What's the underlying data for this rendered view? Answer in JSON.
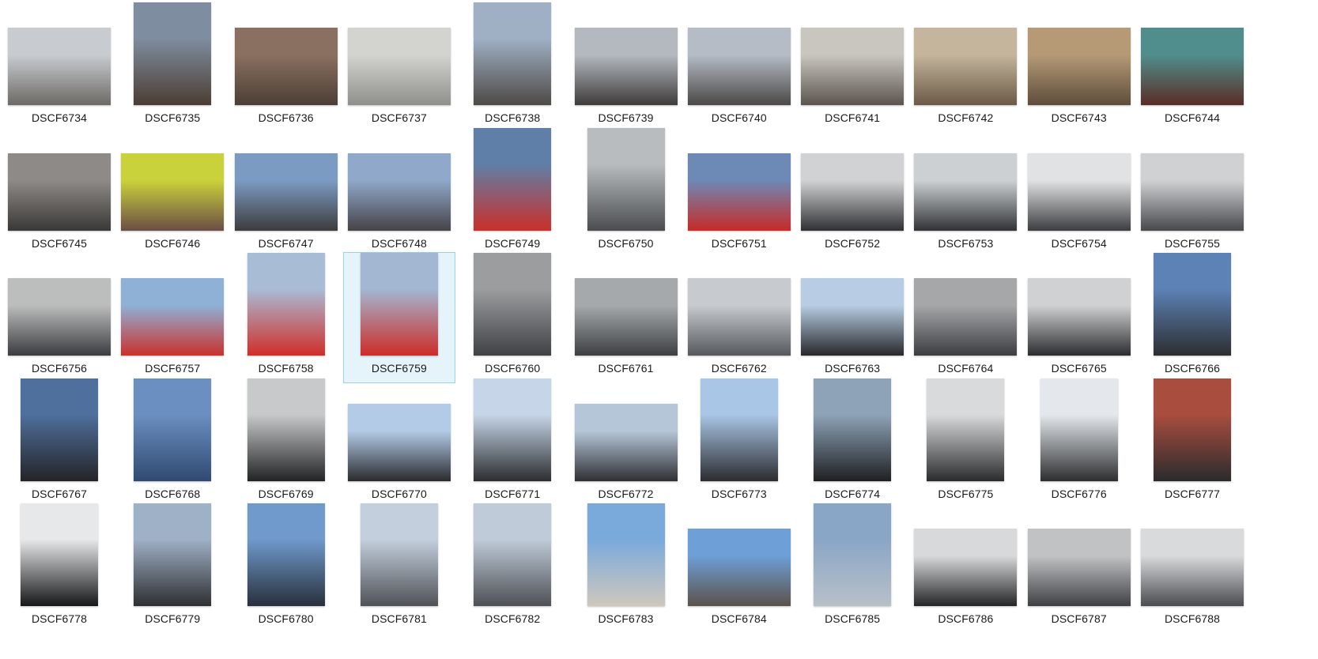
{
  "files": [
    {
      "name": "DSCF6734",
      "orientation": "land",
      "colors": [
        "#c8ccd0",
        "#6d6a66"
      ]
    },
    {
      "name": "DSCF6735",
      "orientation": "port",
      "colors": [
        "#7f8da0",
        "#4b3d33"
      ]
    },
    {
      "name": "DSCF6736",
      "orientation": "land",
      "colors": [
        "#8a7060",
        "#4c3e36"
      ]
    },
    {
      "name": "DSCF6737",
      "orientation": "land",
      "colors": [
        "#d3d3cf",
        "#8f908c"
      ]
    },
    {
      "name": "DSCF6738",
      "orientation": "port",
      "colors": [
        "#9fb0c5",
        "#4e4a46"
      ]
    },
    {
      "name": "DSCF6739",
      "orientation": "land",
      "colors": [
        "#b4b9c0",
        "#3f3c3a"
      ]
    },
    {
      "name": "DSCF6740",
      "orientation": "land",
      "colors": [
        "#b5bcc6",
        "#4b4846"
      ]
    },
    {
      "name": "DSCF6741",
      "orientation": "land",
      "colors": [
        "#c9c5bf",
        "#5b554e"
      ]
    },
    {
      "name": "DSCF6742",
      "orientation": "land",
      "colors": [
        "#c4b59c",
        "#6a5a47"
      ]
    },
    {
      "name": "DSCF6743",
      "orientation": "land",
      "colors": [
        "#b59a75",
        "#5e4d3c"
      ]
    },
    {
      "name": "DSCF6744",
      "orientation": "land",
      "colors": [
        "#4f8e8c",
        "#5a2d26"
      ]
    },
    {
      "name": "DSCF6745",
      "orientation": "land",
      "colors": [
        "#8d8a87",
        "#3a3836"
      ]
    },
    {
      "name": "DSCF6746",
      "orientation": "land",
      "colors": [
        "#c9d23a",
        "#6b4d45"
      ]
    },
    {
      "name": "DSCF6747",
      "orientation": "land",
      "colors": [
        "#7c9bc2",
        "#3c3c3e"
      ]
    },
    {
      "name": "DSCF6748",
      "orientation": "land",
      "colors": [
        "#90a8c9",
        "#454347"
      ]
    },
    {
      "name": "DSCF6749",
      "orientation": "port",
      "colors": [
        "#5f7fa8",
        "#c9302a"
      ]
    },
    {
      "name": "DSCF6750",
      "orientation": "port",
      "colors": [
        "#b9bcbf",
        "#4a4c4f"
      ]
    },
    {
      "name": "DSCF6751",
      "orientation": "land",
      "colors": [
        "#6d89b5",
        "#c72a27"
      ]
    },
    {
      "name": "DSCF6752",
      "orientation": "land",
      "colors": [
        "#d0d2d3",
        "#2f3033"
      ]
    },
    {
      "name": "DSCF6753",
      "orientation": "land",
      "colors": [
        "#cdd0d2",
        "#303236"
      ]
    },
    {
      "name": "DSCF6754",
      "orientation": "land",
      "colors": [
        "#e1e2e3",
        "#3b3d40"
      ]
    },
    {
      "name": "DSCF6755",
      "orientation": "land",
      "colors": [
        "#cfd1d3",
        "#46484b"
      ]
    },
    {
      "name": "DSCF6756",
      "orientation": "land",
      "colors": [
        "#bcbdbd",
        "#3b3c3f"
      ]
    },
    {
      "name": "DSCF6757",
      "orientation": "land",
      "colors": [
        "#8fb1d6",
        "#c9312c"
      ]
    },
    {
      "name": "DSCF6758",
      "orientation": "port",
      "colors": [
        "#a9bcd6",
        "#cf2e2a"
      ]
    },
    {
      "name": "DSCF6759",
      "orientation": "port",
      "colors": [
        "#a3b7d3",
        "#cc2c29"
      ]
    },
    {
      "name": "DSCF6760",
      "orientation": "port",
      "colors": [
        "#9b9d9f",
        "#3f4144"
      ]
    },
    {
      "name": "DSCF6761",
      "orientation": "land",
      "colors": [
        "#a6a9ac",
        "#3d3f42"
      ]
    },
    {
      "name": "DSCF6762",
      "orientation": "land",
      "colors": [
        "#c7cace",
        "#55585c"
      ]
    },
    {
      "name": "DSCF6763",
      "orientation": "land",
      "colors": [
        "#b8cde4",
        "#27282b"
      ]
    },
    {
      "name": "DSCF6764",
      "orientation": "land",
      "colors": [
        "#a5a7a9",
        "#3b3d40"
      ]
    },
    {
      "name": "DSCF6765",
      "orientation": "land",
      "colors": [
        "#cfd1d2",
        "#2b2c2f"
      ]
    },
    {
      "name": "DSCF6766",
      "orientation": "port",
      "colors": [
        "#5c82b6",
        "#2d2e31"
      ]
    },
    {
      "name": "DSCF6767",
      "orientation": "port",
      "colors": [
        "#4f6f9c",
        "#232427"
      ]
    },
    {
      "name": "DSCF6768",
      "orientation": "port",
      "colors": [
        "#6b8fc0",
        "#2f4a72"
      ]
    },
    {
      "name": "DSCF6769",
      "orientation": "port",
      "colors": [
        "#c8c9ca",
        "#222325"
      ]
    },
    {
      "name": "DSCF6770",
      "orientation": "land",
      "colors": [
        "#b3cbe6",
        "#2a2b2e"
      ]
    },
    {
      "name": "DSCF6771",
      "orientation": "port",
      "colors": [
        "#c6d6e8",
        "#2c2d30"
      ]
    },
    {
      "name": "DSCF6772",
      "orientation": "land",
      "colors": [
        "#b5c6d8",
        "#2f3033"
      ]
    },
    {
      "name": "DSCF6773",
      "orientation": "port",
      "colors": [
        "#a9c6e6",
        "#2b2c2f"
      ]
    },
    {
      "name": "DSCF6774",
      "orientation": "port",
      "colors": [
        "#8ea3b8",
        "#1f2022"
      ]
    },
    {
      "name": "DSCF6775",
      "orientation": "port",
      "colors": [
        "#d8dadc",
        "#2a2b2d"
      ]
    },
    {
      "name": "DSCF6776",
      "orientation": "port",
      "colors": [
        "#e4e8ec",
        "#2d2e30"
      ]
    },
    {
      "name": "DSCF6777",
      "orientation": "port",
      "colors": [
        "#a94d3e",
        "#2a2b2d"
      ]
    },
    {
      "name": "DSCF6778",
      "orientation": "port",
      "colors": [
        "#e6e8ea",
        "#161719"
      ]
    },
    {
      "name": "DSCF6779",
      "orientation": "port",
      "colors": [
        "#9fb1c6",
        "#2e2f32"
      ]
    },
    {
      "name": "DSCF6780",
      "orientation": "port",
      "colors": [
        "#6f9acb",
        "#28303c"
      ]
    },
    {
      "name": "DSCF6781",
      "orientation": "port",
      "colors": [
        "#c3cfdc",
        "#505257"
      ]
    },
    {
      "name": "DSCF6782",
      "orientation": "port",
      "colors": [
        "#bfcbd8",
        "#4e5055"
      ]
    },
    {
      "name": "DSCF6783",
      "orientation": "port",
      "colors": [
        "#7aa9dc",
        "#cfc8bc"
      ]
    },
    {
      "name": "DSCF6784",
      "orientation": "land",
      "colors": [
        "#6e9fd6",
        "#5b524b"
      ]
    },
    {
      "name": "DSCF6785",
      "orientation": "port",
      "colors": [
        "#8aa6c6",
        "#b8c0c8"
      ]
    },
    {
      "name": "DSCF6786",
      "orientation": "land",
      "colors": [
        "#d7d9db",
        "#242527"
      ]
    },
    {
      "name": "DSCF6787",
      "orientation": "land",
      "colors": [
        "#c0c2c4",
        "#3e4043"
      ]
    },
    {
      "name": "DSCF6788",
      "orientation": "land",
      "colors": [
        "#d9dadc",
        "#4a4c50"
      ]
    }
  ],
  "selected_index": 25
}
